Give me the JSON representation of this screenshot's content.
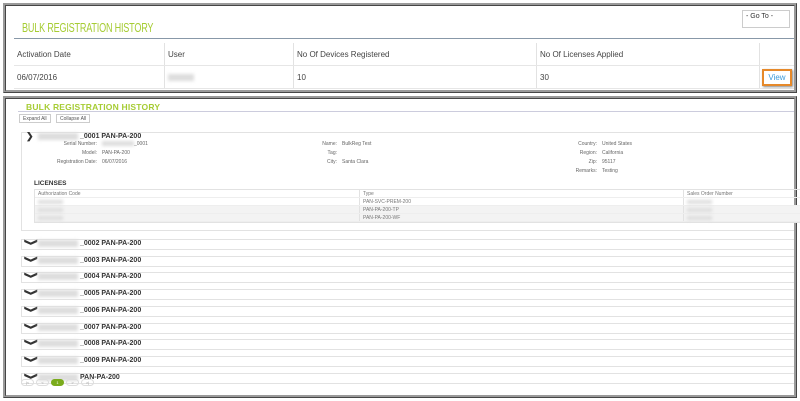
{
  "top": {
    "title": "BULK REGISTRATION HISTORY",
    "goto": "- Go To -",
    "columns": [
      "Activation Date",
      "User",
      "No Of Devices Registered",
      "No Of Licenses Applied"
    ],
    "row": {
      "date": "06/07/2016",
      "devices": "10",
      "licenses": "30",
      "view": "View"
    }
  },
  "bottom": {
    "title": "BULK REGISTRATION HISTORY",
    "expand_all": "Expand All",
    "collapse_all": "Collapse All",
    "expanded": {
      "header": "_0001 PAN-PA-200",
      "left": [
        {
          "k": "Serial Number:",
          "v": "_0001"
        },
        {
          "k": "Model:",
          "v": "PAN-PA-200"
        },
        {
          "k": "Registration Date:",
          "v": "06/07/2016"
        }
      ],
      "mid": [
        {
          "k": "Name:",
          "v": "BulkReg Test"
        },
        {
          "k": "Tag:",
          "v": ""
        },
        {
          "k": "City:",
          "v": "Santa Clara"
        }
      ],
      "right": [
        {
          "k": "Country:",
          "v": "United States"
        },
        {
          "k": "Region:",
          "v": "California"
        },
        {
          "k": "Zip:",
          "v": "95117"
        },
        {
          "k": "Remarks:",
          "v": "Testing"
        }
      ],
      "licenses_title": "LICENSES",
      "license_columns": [
        "Authorization Code",
        "Type",
        "Sales Order Number"
      ],
      "licenses": [
        "PAN-SVC-PREM-200",
        "PAN-PA-200-TP",
        "PAN-PA-200-WF"
      ]
    },
    "collapsed": [
      "_0002 PAN-PA-200",
      "_0003 PAN-PA-200",
      "_0004 PAN-PA-200",
      "_0005 PAN-PA-200",
      "_0006 PAN-PA-200",
      "_0007 PAN-PA-200",
      "_0008 PAN-PA-200",
      "_0009 PAN-PA-200",
      "PAN-PA-200"
    ],
    "pagination": {
      "first": "|<",
      "prev": "<",
      "current": "1",
      "next": ">",
      "last": ">|"
    }
  },
  "colors": {
    "title": "#a6cc34",
    "highlight": "#e6892a",
    "link": "#3a9ad9"
  }
}
